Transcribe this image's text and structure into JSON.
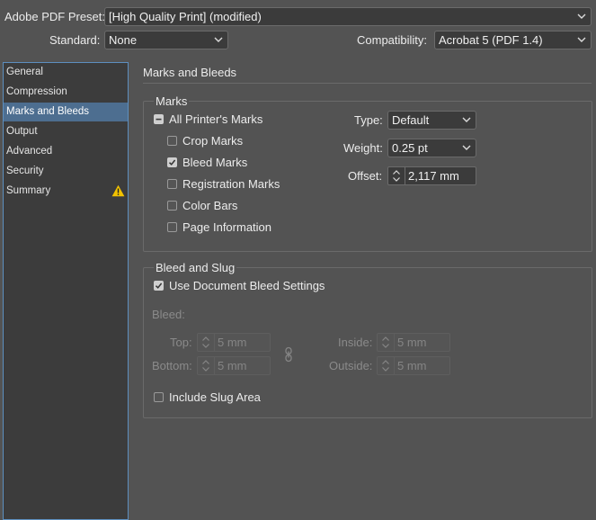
{
  "top": {
    "preset_label": "Adobe PDF Preset:",
    "preset_value": "[High Quality Print] (modified)",
    "standard_label": "Standard:",
    "standard_value": "None",
    "compat_label": "Compatibility:",
    "compat_value": "Acrobat 5 (PDF 1.4)"
  },
  "sidebar": {
    "items": [
      {
        "label": "General"
      },
      {
        "label": "Compression"
      },
      {
        "label": "Marks and Bleeds",
        "selected": true
      },
      {
        "label": "Output"
      },
      {
        "label": "Advanced"
      },
      {
        "label": "Security"
      },
      {
        "label": "Summary",
        "warning": true
      }
    ]
  },
  "panel": {
    "title": "Marks and Bleeds",
    "marks": {
      "legend": "Marks",
      "all_printers_marks": "All Printer's Marks",
      "crop_marks": "Crop Marks",
      "bleed_marks": "Bleed Marks",
      "registration_marks": "Registration Marks",
      "color_bars": "Color Bars",
      "page_information": "Page Information",
      "type_label": "Type:",
      "type_value": "Default",
      "weight_label": "Weight:",
      "weight_value": "0.25 pt",
      "offset_label": "Offset:",
      "offset_value": "2,117 mm"
    },
    "bleed": {
      "legend": "Bleed and Slug",
      "use_document": "Use Document Bleed Settings",
      "bleed_label": "Bleed:",
      "top_label": "Top:",
      "top_value": "5 mm",
      "bottom_label": "Bottom:",
      "bottom_value": "5 mm",
      "inside_label": "Inside:",
      "inside_value": "5 mm",
      "outside_label": "Outside:",
      "outside_value": "5 mm",
      "include_slug": "Include Slug Area"
    }
  },
  "colors": {
    "background": "#535353",
    "selection": "#4d6e90",
    "warning": "#f2c200"
  }
}
